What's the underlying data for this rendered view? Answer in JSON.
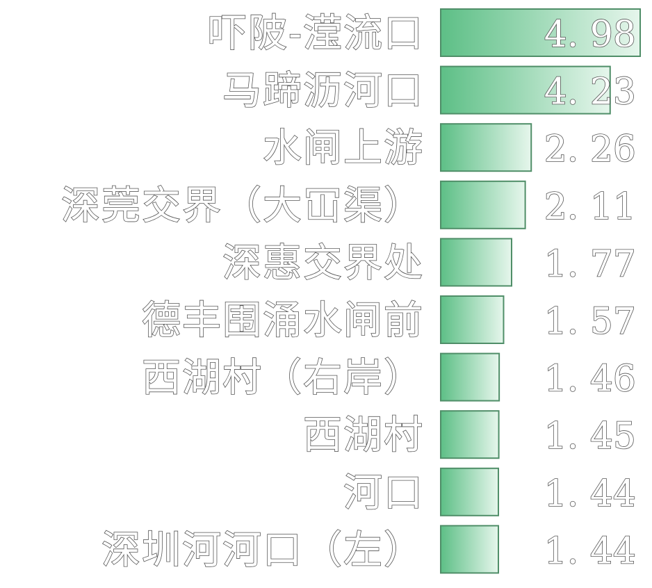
{
  "chart_data": {
    "type": "bar",
    "orientation": "horizontal",
    "categories": [
      "吓陂-滢流口",
      "马蹄沥河口",
      "水闸上游",
      "深莞交界（大冚渠）",
      "深惠交界处",
      "德丰围涌水闸前",
      "西湖村（右岸）",
      "西湖村",
      "河口",
      "深圳河河口（左）"
    ],
    "values": [
      4.98,
      4.23,
      2.26,
      2.11,
      1.77,
      1.57,
      1.46,
      1.45,
      1.44,
      1.44
    ],
    "value_labels": [
      "4. 98",
      "4. 23",
      "2. 26",
      "2. 11",
      "1. 77",
      "1. 57",
      "1. 46",
      "1. 45",
      "1. 44",
      "1. 44"
    ],
    "xlim": [
      0,
      5
    ],
    "grid": false,
    "legend": "none",
    "colors": {
      "bar_dark": "#5dbf86",
      "bar_light": "#e6f6ec",
      "bar_stroke": "#4f8e68",
      "text_fill": "#ffffff",
      "text_stroke": "#555555"
    }
  }
}
